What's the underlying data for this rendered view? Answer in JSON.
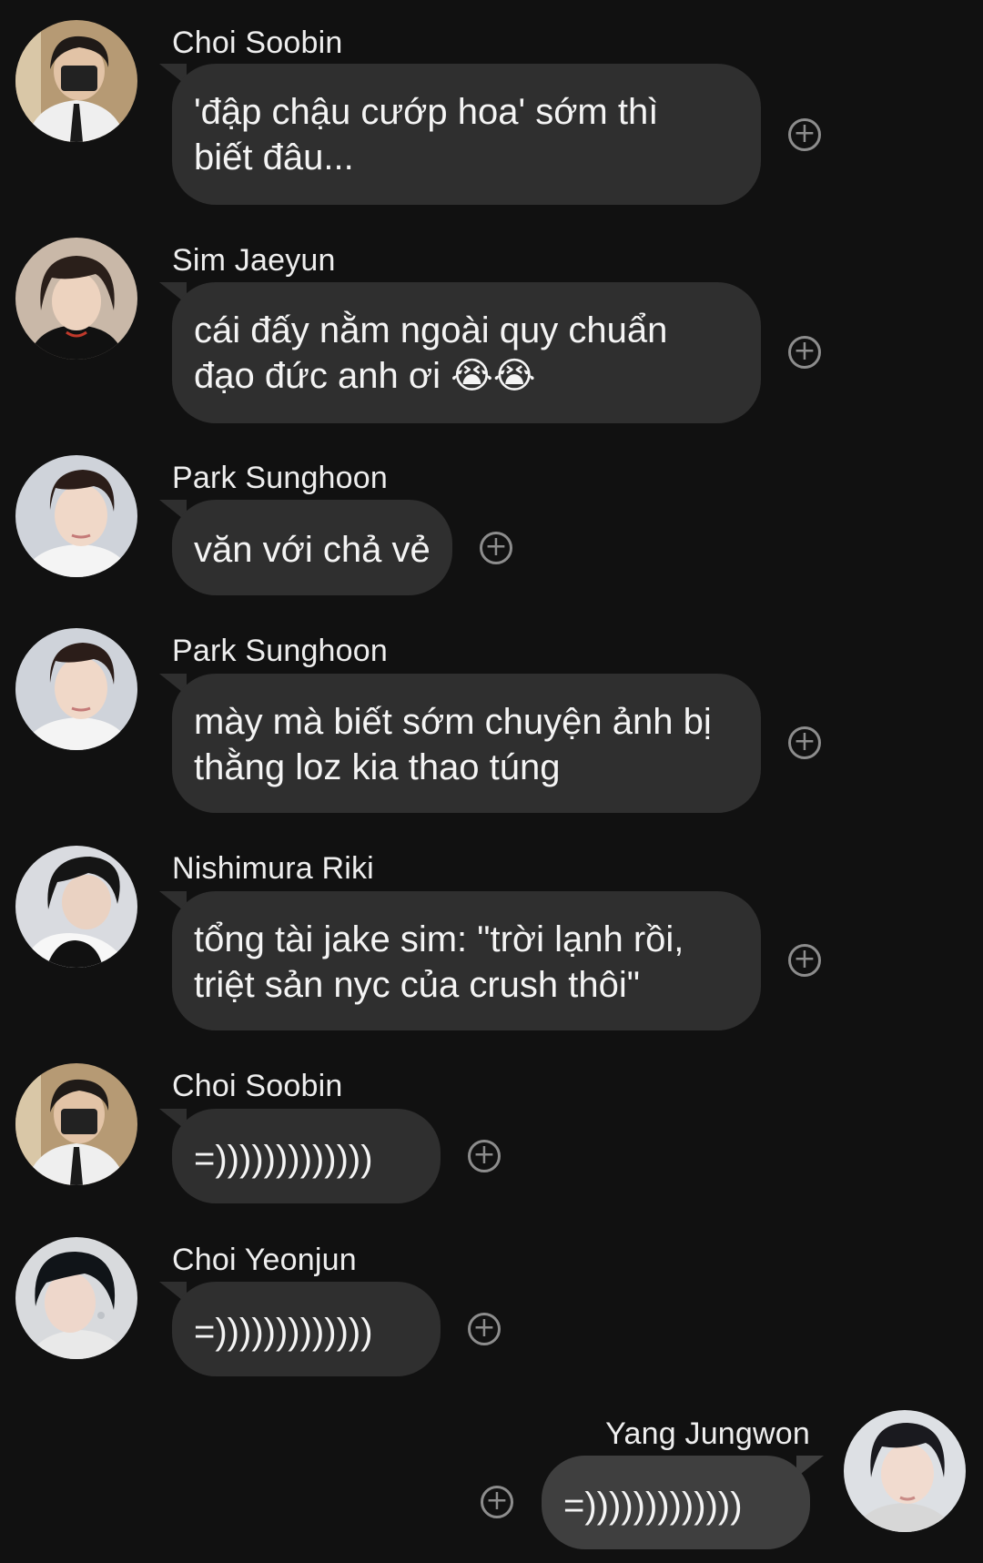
{
  "messages": [
    {
      "sender": "Choi Soobin",
      "lines": [
        "'đập chậu cướp hoa' sớm thì",
        "biết đâu..."
      ],
      "avatar_colors": {
        "bg": "#b69a74",
        "hair": "#1f1a17",
        "skin": "#e2c3a6",
        "shirt": "#efefef"
      }
    },
    {
      "sender": "Sim Jaeyun",
      "lines": [
        "cái đấy nằm ngoài quy chuẩn",
        "đạo đức anh ơi 😭😭"
      ],
      "avatar_colors": {
        "bg": "#c9b8a8",
        "hair": "#2a1f1a",
        "skin": "#edd3bf",
        "shirt": "#111111"
      }
    },
    {
      "sender": "Park Sunghoon",
      "lines": [
        "văn với chả vẻ"
      ],
      "avatar_colors": {
        "bg": "#cfd3da",
        "hair": "#2b1d19",
        "skin": "#f0d8c8",
        "shirt": "#f4f4f4"
      }
    },
    {
      "sender": "Park Sunghoon",
      "lines": [
        "mày mà biết sớm chuyện ảnh bị",
        "thằng loz kia thao túng"
      ],
      "avatar_colors": {
        "bg": "#cfd3da",
        "hair": "#2b1d19",
        "skin": "#f0d8c8",
        "shirt": "#f4f4f4"
      }
    },
    {
      "sender": "Nishimura Riki",
      "lines": [
        "tổng tài jake sim: \"trời lạnh rồi,",
        "triệt sản nyc của crush thôi\""
      ],
      "avatar_colors": {
        "bg": "#d9dbe0",
        "hair": "#151515",
        "skin": "#ead2c2",
        "shirt": "#f7f7f7"
      }
    },
    {
      "sender": "Choi Soobin",
      "lines": [
        "=)))))))))))))"
      ],
      "avatar_colors": {
        "bg": "#b69a74",
        "hair": "#1f1a17",
        "skin": "#e2c3a6",
        "shirt": "#efefef"
      }
    },
    {
      "sender": "Choi Yeonjun",
      "lines": [
        "=)))))))))))))"
      ],
      "avatar_colors": {
        "bg": "#d8dadd",
        "hair": "#101418",
        "skin": "#eed7cb",
        "shirt": "#e9e9e9"
      }
    },
    {
      "sender": "Yang Jungwon",
      "lines": [
        "=)))))))))))))"
      ],
      "outgoing": true,
      "avatar_colors": {
        "bg": "#dde0e4",
        "hair": "#1a1a1f",
        "skin": "#f1dbcf",
        "shirt": "#d7d7d7"
      }
    }
  ],
  "react_icon": "add-reaction-icon",
  "react_glyph": "+",
  "colors": {
    "background": "#111111",
    "bubble": "#2f2f2f",
    "bubble_outgoing": "#3f3f3f",
    "text": "#f4f4f4",
    "react_icon": "#8d8d8d"
  }
}
